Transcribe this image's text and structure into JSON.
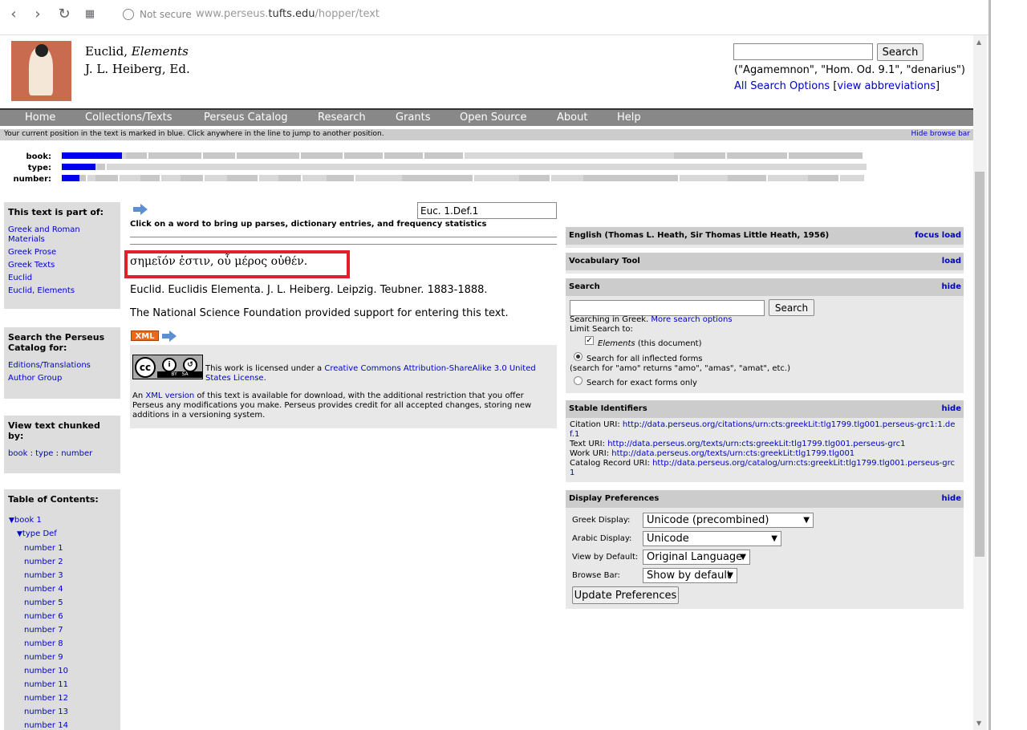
{
  "browser": {
    "security_label": "Not secure",
    "url_prefix": "www.perseus.",
    "url_domain": "tufts.edu",
    "url_path": "/hopper/text"
  },
  "header": {
    "title": "Euclid,",
    "title_italic": "Elements",
    "editor": "J. L. Heiberg, Ed.",
    "search_button": "Search",
    "search_examples": "(\"Agamemnon\", \"Hom. Od. 9.1\", \"denarius\")",
    "all_search_options": "All Search Options",
    "view_abbreviations": "view abbreviations"
  },
  "nav": {
    "items": [
      "Home",
      "Collections/Texts",
      "Perseus Catalog",
      "Research",
      "Grants",
      "Open Source",
      "About",
      "Help"
    ]
  },
  "info_strip": {
    "text": "Your current position in the text is marked in blue. Click anywhere in the line to jump to another position.",
    "hide_label": "Hide browse bar"
  },
  "browse_bar": {
    "labels": [
      "book:",
      "type:",
      "number:"
    ],
    "book_position": 0.075,
    "type_position": 0.042,
    "number_position": 0.022
  },
  "sidebar": {
    "part_of": {
      "heading": "This text is part of:",
      "links": [
        "Greek and Roman Materials",
        "Greek Prose",
        "Greek Texts",
        "Euclid",
        "Euclid, Elements"
      ]
    },
    "catalog": {
      "heading": "Search the Perseus Catalog for:",
      "links": [
        "Editions/Translations",
        "Author Group"
      ]
    },
    "chunked": {
      "heading": "View text chunked by:",
      "book": "book",
      "sep1": ":",
      "type": "type",
      "sep2": ":",
      "number": "number"
    },
    "toc": {
      "heading": "Table of Contents:",
      "book": "book 1",
      "type": "type Def",
      "numbers": [
        "number 1",
        "number 2",
        "number 3",
        "number 4",
        "number 5",
        "number 6",
        "number 7",
        "number 8",
        "number 9",
        "number 10",
        "number 11",
        "number 12",
        "number 13",
        "number 14"
      ]
    }
  },
  "main": {
    "citation": "Euc. 1.Def.1",
    "click_note": "Click on a word to bring up parses, dictionary entries, and frequency statistics",
    "greek_text": "σημεῖόν ἐστιν, οὗ μέρος οὐθέν.",
    "source": "Euclid. Euclidis Elementa. J. L. Heiberg. Leipzig. Teubner. 1883-1888.",
    "nsf": "The National Science Foundation provided support for entering this text.",
    "xml_badge": "XML",
    "license_prefix": "This work is licensed under a ",
    "license_link": "Creative Commons Attribution-ShareAlike 3.0 United States License",
    "license_suffix": ".",
    "xml_note_prefix": "An ",
    "xml_note_link": "XML version",
    "xml_note_suffix": " of this text is available for download, with the additional restriction that you offer Perseus any modifications you make. Perseus provides credit for all accepted changes, storing new additions in a versioning system.",
    "cc_label": "cc",
    "cc_by": "BY",
    "cc_sa": "SA"
  },
  "right": {
    "english": {
      "title": "English (Thomas L. Heath, Sir Thomas Little Heath, 1956)",
      "focus": "focus",
      "load": "load"
    },
    "vocab": {
      "title": "Vocabulary Tool",
      "load": "load"
    },
    "search": {
      "title": "Search",
      "hide": "hide",
      "button": "Search",
      "searching_in": "Searching in Greek.",
      "more_options": "More search options",
      "limit": "Limit Search to:",
      "elements_label": "Elements",
      "elements_suffix": "(this document)",
      "inflected": "Search for all inflected forms",
      "inflected_note": "(search for \"amo\" returns \"amo\", \"amas\", \"amat\", etc.)",
      "exact": "Search for exact forms only"
    },
    "stable": {
      "title": "Stable Identifiers",
      "hide": "hide",
      "citation_label": "Citation URI:",
      "citation_uri": "http://data.perseus.org/citations/urn:cts:greekLit:tlg1799.tlg001.perseus-grc1:1.def.1",
      "text_label": "Text URI:",
      "text_uri": "http://data.perseus.org/texts/urn:cts:greekLit:tlg1799.tlg001.perseus-grc1",
      "work_label": "Work URI:",
      "work_uri": "http://data.perseus.org/texts/urn:cts:greekLit:tlg1799.tlg001",
      "catalog_label": "Catalog Record URI:",
      "catalog_uri": "http://data.perseus.org/catalog/urn:cts:greekLit:tlg1799.tlg001.perseus-grc1"
    },
    "prefs": {
      "title": "Display Preferences",
      "hide": "hide",
      "greek_label": "Greek Display:",
      "greek_value": "Unicode (precombined)",
      "arabic_label": "Arabic Display:",
      "arabic_value": "Unicode",
      "view_label": "View by Default:",
      "view_value": "Original Language",
      "browse_label": "Browse Bar:",
      "browse_value": "Show by default",
      "update": "Update Preferences"
    }
  },
  "colors": {
    "link": "#0000cc",
    "nav_bg": "#888888",
    "highlight_box": "#e0202c",
    "browse_current": "#0000ee",
    "xml_badge": "#e86a1a"
  }
}
